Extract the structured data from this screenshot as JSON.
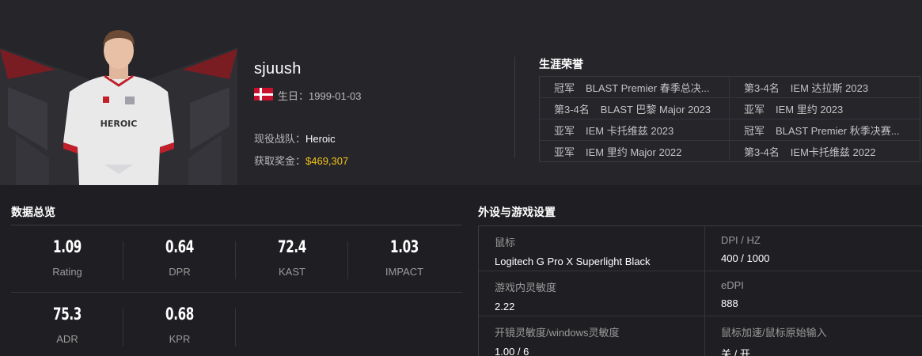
{
  "player": {
    "name": "sjuush",
    "birthday": "生日：1999-01-03",
    "team_label": "现役战队：",
    "team": "Heroic",
    "prize_label": "获取奖金：",
    "prize": "$469,307",
    "jersey_text": "HEROIC"
  },
  "colors": {
    "banner_bg": "#25252a",
    "page_bg": "#1f1f23",
    "prize": "#f5c518",
    "flag_red": "#c8102e"
  },
  "honors": {
    "title": "生涯荣誉",
    "items": [
      {
        "rank": "冠军",
        "event": "BLAST Premier 春季总决..."
      },
      {
        "rank": "第3-4名",
        "event": "IEM 达拉斯 2023"
      },
      {
        "rank": "第3-4名",
        "event": "BLAST 巴黎 Major 2023"
      },
      {
        "rank": "亚军",
        "event": "IEM 里约 2023"
      },
      {
        "rank": "亚军",
        "event": "IEM 卡托维兹 2023"
      },
      {
        "rank": "冠军",
        "event": "BLAST Premier 秋季决赛..."
      },
      {
        "rank": "亚军",
        "event": "IEM 里约 Major 2022"
      },
      {
        "rank": "第3-4名",
        "event": "IEM卡托维兹 2022"
      }
    ]
  },
  "stats": {
    "title": "数据总览",
    "items": [
      {
        "value": "1.09",
        "label": "Rating"
      },
      {
        "value": "0.64",
        "label": "DPR"
      },
      {
        "value": "72.4",
        "label": "KAST"
      },
      {
        "value": "1.03",
        "label": "IMPACT"
      },
      {
        "value": "75.3",
        "label": "ADR"
      },
      {
        "value": "0.68",
        "label": "KPR"
      }
    ]
  },
  "gear": {
    "title": "外设与游戏设置",
    "items": [
      {
        "key": "鼠标",
        "value": "Logitech G Pro X Superlight Black"
      },
      {
        "key": "DPI / HZ",
        "value": "400 / 1000"
      },
      {
        "key": "游戏内灵敏度",
        "value": "2.22"
      },
      {
        "key": "eDPI",
        "value": "888"
      },
      {
        "key": "开镜灵敏度/windows灵敏度",
        "value": "1.00 / 6"
      },
      {
        "key": "鼠标加速/鼠标原始输入",
        "value": "关 / 开"
      }
    ]
  }
}
